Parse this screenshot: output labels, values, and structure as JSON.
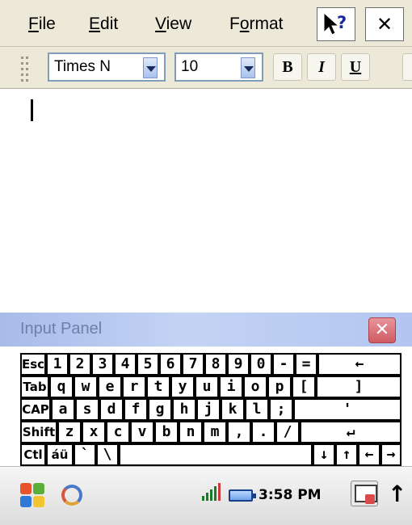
{
  "menu": [
    {
      "accel": "F",
      "rest": "ile"
    },
    {
      "accel": "E",
      "rest": "dit"
    },
    {
      "accel": "V",
      "rest": "iew"
    },
    {
      "pre": "F",
      "accel": "o",
      "rest": "rmat"
    }
  ],
  "close_glyph": "✕",
  "toolbar": {
    "font_name": "Times N",
    "font_size": "10",
    "bold": "B",
    "italic": "I",
    "underline": "U"
  },
  "input_panel": {
    "title": "Input Panel",
    "close_glyph": "✕"
  },
  "keyboard": {
    "rows": [
      [
        "Esc",
        "1",
        "2",
        "3",
        "4",
        "5",
        "6",
        "7",
        "8",
        "9",
        "0",
        "-",
        "=",
        "←"
      ],
      [
        "Tab",
        "q",
        "w",
        "e",
        "r",
        "t",
        "y",
        "u",
        "i",
        "o",
        "p",
        "[",
        "]"
      ],
      [
        "CAP",
        "a",
        "s",
        "d",
        "f",
        "g",
        "h",
        "j",
        "k",
        "l",
        ";",
        "'"
      ],
      [
        "Shift",
        "z",
        "x",
        "c",
        "v",
        "b",
        "n",
        "m",
        ",",
        ".",
        "/",
        "↵"
      ],
      [
        "Ctl",
        "áü",
        "`",
        "\\",
        " ",
        "↓",
        "↑",
        "←",
        "→"
      ]
    ]
  },
  "taskbar": {
    "clock": "3:58 PM",
    "kb_arrow": "↑"
  },
  "colors": {
    "title_bar": "#b3c6f0",
    "menubar_bg": "#ece9d8"
  }
}
